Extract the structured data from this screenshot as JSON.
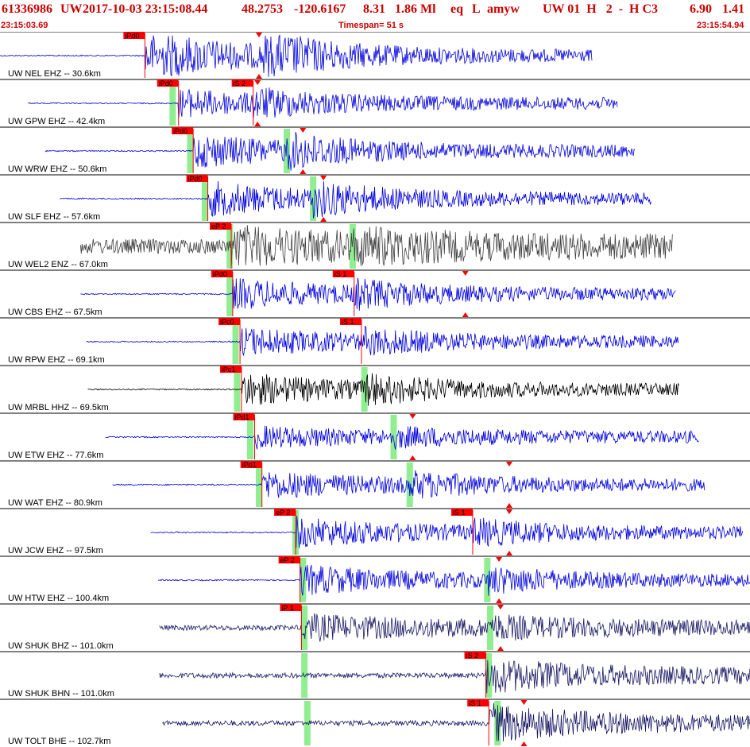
{
  "header": {
    "event_id": "61336986",
    "network": "UW",
    "datetime": "2017-10-03 23:15:08.44",
    "lat": "48.2753",
    "lon": "-120.6167",
    "depth": "8.31",
    "magnitude": "1.86 Ml",
    "event_type": "eq",
    "flag": "L",
    "author": "amyw",
    "quality": "UW 01  H   2  -  H C3",
    "extra1": "6.90",
    "extra2": "1.41"
  },
  "subheader": {
    "start_time": "23:15:03.69",
    "timespan": "Timespan=  51 s",
    "end_time": "23:15:54.94"
  },
  "colors": {
    "header_text": "#cc0000",
    "trace_blue": "#0000e0",
    "trace_black": "#000000",
    "trace_gray": "#404040",
    "trace_navy": "#1a1a66",
    "pick_box": "#ff0000",
    "pick_window": "#90ee90",
    "divider": "#000000"
  },
  "chart_data": {
    "type": "line",
    "title": "",
    "xlabel": "",
    "ylabel": "",
    "time_range_s": [
      0,
      51.25
    ],
    "grid": false,
    "legend": "none",
    "traces": [
      {
        "label": "UW NEL EHZ -- 30.6km",
        "color": "blue",
        "trace_start_s": 0.0,
        "trace_end_s": 40.5,
        "amp": 0.95,
        "decay": 0.05,
        "picks": [
          {
            "label": "iPd0",
            "t": 9.9,
            "kind": "P"
          }
        ],
        "windows": [],
        "markers": [
          {
            "t": 17.7
          }
        ]
      },
      {
        "label": "UW GPW EHZ -- 42.4km",
        "color": "blue",
        "trace_start_s": 1.9,
        "trace_end_s": 42.2,
        "amp": 0.45,
        "decay": 0.05,
        "picks": [
          {
            "label": "iPd0",
            "t": 12.2,
            "kind": "P"
          },
          {
            "label": "iS 2",
            "t": 17.3,
            "kind": "S"
          }
        ],
        "windows": [
          {
            "t": 11.8
          }
        ],
        "markers": [
          {
            "t": 17.6
          }
        ]
      },
      {
        "label": "UW WRW EHZ -- 50.6km",
        "color": "blue",
        "trace_start_s": 3.1,
        "trace_end_s": 43.4,
        "amp": 0.6,
        "decay": 0.04,
        "picks": [
          {
            "label": "iPd0",
            "t": 13.2,
            "kind": "P"
          }
        ],
        "windows": [
          {
            "t": 13.0
          },
          {
            "t": 19.6
          }
        ],
        "markers": [
          {
            "t": 20.7
          }
        ]
      },
      {
        "label": "UW SLF EHZ -- 57.6km",
        "color": "blue",
        "trace_start_s": 4.1,
        "trace_end_s": 44.5,
        "amp": 0.6,
        "decay": 0.05,
        "picks": [
          {
            "label": "iPd0",
            "t": 14.2,
            "kind": "P"
          }
        ],
        "windows": [
          {
            "t": 14.0
          },
          {
            "t": 21.4
          }
        ],
        "markers": [
          {
            "t": 22.1
          }
        ]
      },
      {
        "label": "UW WEL2 ENZ -- 67.0km",
        "color": "gray",
        "trace_start_s": 5.5,
        "trace_end_s": 46.0,
        "amp": 0.5,
        "decay": 0.02,
        "picks": [
          {
            "label": "eP 2",
            "t": 15.8,
            "kind": "P"
          }
        ],
        "windows": [
          {
            "t": 15.7
          },
          {
            "t": 24.1
          }
        ],
        "markers": []
      },
      {
        "label": "UW CBS EHZ -- 67.5km",
        "color": "blue",
        "trace_start_s": 5.5,
        "trace_end_s": 46.2,
        "amp": 0.5,
        "decay": 0.03,
        "picks": [
          {
            "label": "iPd0",
            "t": 15.9,
            "kind": "P"
          },
          {
            "label": "iS 1",
            "t": 24.2,
            "kind": "S"
          }
        ],
        "windows": [
          {
            "t": 15.7
          }
        ],
        "markers": [
          {
            "t": 31.8
          }
        ]
      },
      {
        "label": "UW RPW EHZ -- 69.1km",
        "color": "blue",
        "trace_start_s": 5.9,
        "trace_end_s": 46.4,
        "amp": 0.45,
        "decay": 0.05,
        "picks": [
          {
            "label": "iPc0",
            "t": 16.4,
            "kind": "P"
          },
          {
            "label": "iS 1",
            "t": 24.7,
            "kind": "S"
          }
        ],
        "windows": [
          {
            "t": 16.1
          }
        ],
        "markers": []
      },
      {
        "label": "UW MRBL HHZ -- 69.5km",
        "color": "black",
        "trace_start_s": 6.0,
        "trace_end_s": 46.4,
        "amp": 0.55,
        "decay": 0.04,
        "picks": [
          {
            "label": "iPc1",
            "t": 16.5,
            "kind": "P"
          }
        ],
        "windows": [
          {
            "t": 16.2
          },
          {
            "t": 24.9
          }
        ],
        "markers": []
      },
      {
        "label": "UW ETW EHZ -- 77.6km",
        "color": "blue",
        "trace_start_s": 7.2,
        "trace_end_s": 47.8,
        "amp": 0.3,
        "decay": 0.05,
        "picks": [
          {
            "label": "iPd1",
            "t": 17.4,
            "kind": "P"
          }
        ],
        "windows": [
          {
            "t": 17.1
          },
          {
            "t": 26.9
          }
        ],
        "markers": [
          {
            "t": 28.2
          }
        ]
      },
      {
        "label": "UW WAT EHZ -- 80.9km",
        "color": "blue",
        "trace_start_s": 7.7,
        "trace_end_s": 48.2,
        "amp": 0.45,
        "decay": 0.03,
        "picks": [
          {
            "label": "iPd1",
            "t": 17.9,
            "kind": "P"
          }
        ],
        "windows": [
          {
            "t": 17.7
          },
          {
            "t": 28.0
          }
        ],
        "markers": [
          {
            "t": 34.8
          }
        ]
      },
      {
        "label": "UW JCW EHZ -- 97.5km",
        "color": "blue",
        "trace_start_s": 10.3,
        "trace_end_s": 50.8,
        "amp": 0.5,
        "decay": 0.03,
        "picks": [
          {
            "label": "eP 2",
            "t": 20.2,
            "kind": "P"
          },
          {
            "label": "iS 1",
            "t": 32.3,
            "kind": "S"
          }
        ],
        "windows": [
          {
            "t": 20.2
          }
        ],
        "markers": [
          {
            "t": 34.8
          }
        ]
      },
      {
        "label": "UW HTW EHZ -- 100.4km",
        "color": "blue",
        "trace_start_s": 10.8,
        "trace_end_s": 51.25,
        "amp": 0.5,
        "decay": 0.03,
        "picks": [
          {
            "label": "eP 2",
            "t": 20.5,
            "kind": "P"
          }
        ],
        "windows": [
          {
            "t": 20.7
          },
          {
            "t": 33.3
          }
        ],
        "markers": [
          {
            "t": 34.1
          }
        ]
      },
      {
        "label": "UW SHUK BHZ -- 101.0km",
        "color": "navy",
        "trace_start_s": 10.9,
        "trace_end_s": 51.25,
        "amp": 0.35,
        "decay": 0.02,
        "picks": [
          {
            "label": "iP 1",
            "t": 20.6,
            "kind": "P"
          }
        ],
        "windows": [
          {
            "t": 20.8
          },
          {
            "t": 33.5
          }
        ],
        "markers": [
          {
            "t": 34.2
          }
        ]
      },
      {
        "label": "UW SHUK BHN -- 101.0km",
        "color": "navy",
        "trace_start_s": 10.9,
        "trace_end_s": 51.25,
        "amp": 0.3,
        "decay": 0.02,
        "picks": [
          {
            "label": "iS 2",
            "t": 33.2,
            "kind": "S"
          }
        ],
        "windows": [
          {
            "t": 20.8
          },
          {
            "t": 33.4
          }
        ],
        "markers": []
      },
      {
        "label": "UW TOLT BHE -- 102.7km",
        "color": "navy",
        "trace_start_s": 11.1,
        "trace_end_s": 51.25,
        "amp": 0.35,
        "decay": 0.02,
        "picks": [
          {
            "label": "iS 1",
            "t": 33.4,
            "kind": "S"
          }
        ],
        "windows": [
          {
            "t": 21.0
          },
          {
            "t": 34.0
          }
        ],
        "markers": [
          {
            "t": 35.8
          }
        ]
      }
    ]
  }
}
